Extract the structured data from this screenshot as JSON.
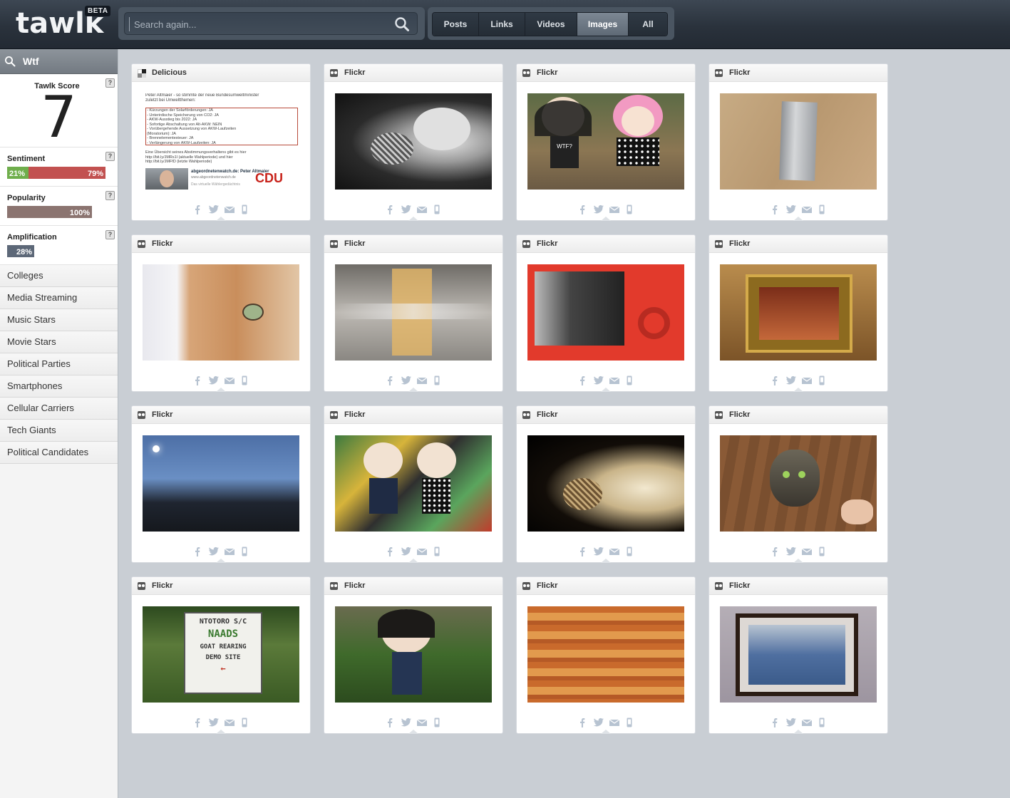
{
  "header": {
    "logo": "tawlk",
    "badge": "BETA",
    "search_placeholder": "Search again...",
    "tabs": [
      {
        "label": "Posts",
        "active": false
      },
      {
        "label": "Links",
        "active": false
      },
      {
        "label": "Videos",
        "active": false
      },
      {
        "label": "Images",
        "active": true
      },
      {
        "label": "All",
        "active": false
      }
    ]
  },
  "sidebar": {
    "query": "Wtf",
    "score_label": "Tawlk Score",
    "score_value": "7",
    "help": "?",
    "sentiment": {
      "label": "Sentiment",
      "positive": "21%",
      "negative": "79%",
      "positive_color": "#6fae4c",
      "negative_color": "#c25150"
    },
    "popularity": {
      "label": "Popularity",
      "value": "100%",
      "color": "#8b7470"
    },
    "amplification": {
      "label": "Amplification",
      "value": "28%",
      "color": "#5d6878"
    },
    "categories": [
      "Colleges",
      "Media Streaming",
      "Music Stars",
      "Movie Stars",
      "Political Parties",
      "Smartphones",
      "Cellular Carriers",
      "Tech Giants",
      "Political Candidates"
    ]
  },
  "cards": [
    {
      "source": "Delicious",
      "icon": "delicious-icon"
    },
    {
      "source": "Flickr",
      "icon": "flickr-icon"
    },
    {
      "source": "Flickr",
      "icon": "flickr-icon"
    },
    {
      "source": "Flickr",
      "icon": "flickr-icon"
    },
    {
      "source": "Flickr",
      "icon": "flickr-icon"
    },
    {
      "source": "Flickr",
      "icon": "flickr-icon"
    },
    {
      "source": "Flickr",
      "icon": "flickr-icon"
    },
    {
      "source": "Flickr",
      "icon": "flickr-icon"
    },
    {
      "source": "Flickr",
      "icon": "flickr-icon"
    },
    {
      "source": "Flickr",
      "icon": "flickr-icon"
    },
    {
      "source": "Flickr",
      "icon": "flickr-icon"
    },
    {
      "source": "Flickr",
      "icon": "flickr-icon"
    },
    {
      "source": "Flickr",
      "icon": "flickr-icon"
    },
    {
      "source": "Flickr",
      "icon": "flickr-icon"
    },
    {
      "source": "Flickr",
      "icon": "flickr-icon"
    },
    {
      "source": "Flickr",
      "icon": "flickr-icon"
    }
  ],
  "share_icons": [
    "facebook-icon",
    "twitter-icon",
    "email-icon",
    "mobile-icon"
  ],
  "delicious_doc": {
    "lines": [
      "Peter Altmaier - so stimmte der neue Bundesumweltminister",
      "zuletzt bei Umweltthemen:",
      "- Kürzungen der Solarförderungen: JA",
      "- Unterirdische Speicherung von CO2: JA",
      "- AKW-Ausstieg bis 2022: JA",
      "- Sofortige Abschaltung von Alt-AKW: NEIN",
      "- Vorübergehende Aussetzung von AKW-Laufzeiten",
      "(Moratorium): JA",
      "- Brennelementesteuer: JA",
      "- Verlängerung von AKW-Laufzeiten: JA",
      "Eine Übersicht seines Abstimmungsverhaltens gibt es hier",
      "http://bit.ly/JMRs1l (aktuelle Wahlperiode) und hier",
      "http://bit.ly/JMFfD (letzte Wahlperiode)"
    ],
    "link_title": "abgeordnetenwatch.de: Peter Altmaier",
    "link_url": "www.abgeordnetenwatch.de",
    "link_desc": "Das virtuelle Wählergedächtnis",
    "party": "CDU"
  },
  "thumb_sign": {
    "line1": "NTOTORO S/C",
    "line2": "NAADS",
    "line3": "GOAT REARING",
    "line4": "DEMO SITE"
  },
  "doll_shirt": "WTF?"
}
